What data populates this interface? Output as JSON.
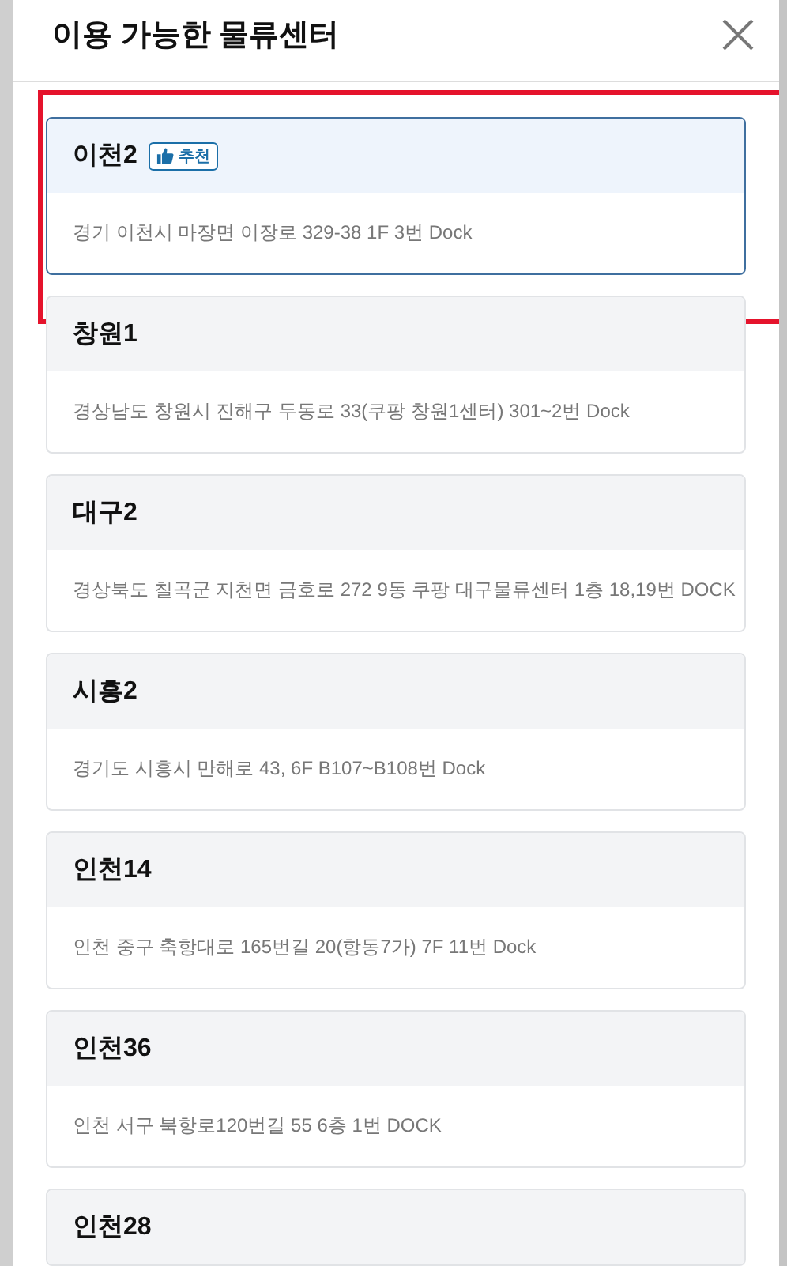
{
  "dialog": {
    "title": "이용 가능한 물류센터"
  },
  "centers": [
    {
      "name": "이천2",
      "recommended": true,
      "badge": "추천",
      "selected": true,
      "highlighted": true,
      "address": "경기 이천시 마장면 이장로 329-38 1F 3번 Dock"
    },
    {
      "name": "창원1",
      "recommended": false,
      "selected": false,
      "highlighted": false,
      "address": "경상남도 창원시 진해구 두동로 33(쿠팡 창원1센터) 301~2번 Dock"
    },
    {
      "name": "대구2",
      "recommended": false,
      "selected": false,
      "highlighted": false,
      "address": "경상북도 칠곡군 지천면 금호로 272 9동 쿠팡 대구물류센터 1층 18,19번 DOCK"
    },
    {
      "name": "시흥2",
      "recommended": false,
      "selected": false,
      "highlighted": false,
      "address": "경기도 시흥시 만해로 43, 6F B107~B108번 Dock"
    },
    {
      "name": "인천14",
      "recommended": false,
      "selected": false,
      "highlighted": false,
      "address": "인천 중구 축항대로 165번길 20(항동7가) 7F 11번 Dock"
    },
    {
      "name": "인천36",
      "recommended": false,
      "selected": false,
      "highlighted": false,
      "address": "인천 서구 북항로120번길 55 6층 1번 DOCK"
    },
    {
      "name": "인천28",
      "recommended": false,
      "selected": false,
      "highlighted": false
    }
  ]
}
